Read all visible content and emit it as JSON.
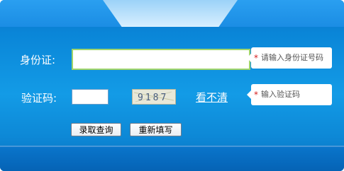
{
  "form": {
    "id_label": "身份证:",
    "code_label": "验证码:",
    "id_value": "",
    "code_value": "",
    "captcha_text": "9187",
    "refresh_link": "看不清",
    "id_hint_star": "*",
    "id_hint": "请输入身份证号码",
    "code_hint_star": "*",
    "code_hint": "输入验证码"
  },
  "buttons": {
    "query_label": "录取查询",
    "reset_label": "重新填写"
  },
  "colors": {
    "panel_blue": "#0d88d6",
    "input_border_active": "#9fd46b",
    "required_star": "#d62020"
  }
}
